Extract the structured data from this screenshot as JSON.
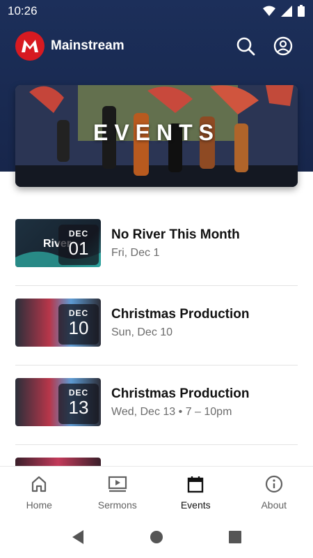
{
  "status": {
    "time": "10:26"
  },
  "app": {
    "title": "Mainstream"
  },
  "hero": {
    "title": "EVENTS"
  },
  "events": [
    {
      "title": "No River This Month",
      "date": "Fri, Dec 1",
      "month": "DEC",
      "day": "01",
      "thumb_text": "River"
    },
    {
      "title": "Christmas Production",
      "date": "Sun, Dec 10",
      "month": "DEC",
      "day": "10"
    },
    {
      "title": "Christmas Production",
      "date": "Wed, Dec 13 • 7 – 10pm",
      "month": "DEC",
      "day": "13"
    }
  ],
  "nav": [
    {
      "label": "Home",
      "icon": "home-icon"
    },
    {
      "label": "Sermons",
      "icon": "video-icon"
    },
    {
      "label": "Events",
      "icon": "calendar-icon",
      "active": true
    },
    {
      "label": "About",
      "icon": "info-icon"
    }
  ],
  "colors": {
    "header": "#1c2f5a",
    "brand_red": "#d71a21",
    "text_dark": "#111111",
    "text_muted": "#6b6b6b"
  }
}
